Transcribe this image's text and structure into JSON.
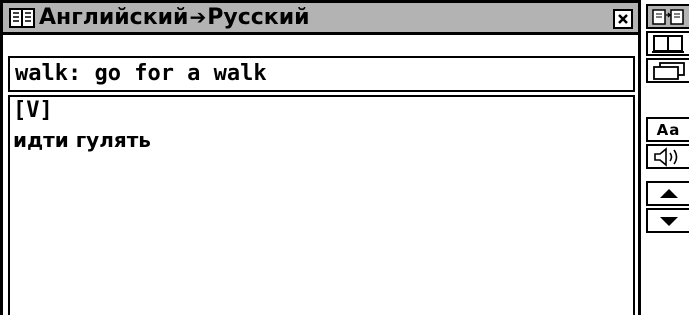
{
  "window": {
    "title_from": "Английский",
    "title_arrow": "➔",
    "title_to": "Русский",
    "close_glyph": "×"
  },
  "input": {
    "value": "walk: go for a walk"
  },
  "entry": {
    "part_of_speech": "[V]",
    "translation": "идти гулять"
  },
  "toolbar": {
    "buttons": [
      {
        "icon": "swap-languages-icon"
      },
      {
        "icon": "dictionary-book-icon"
      },
      {
        "icon": "cards-icon"
      },
      {
        "icon": "font-size-icon",
        "label": "Aa"
      },
      {
        "icon": "speaker-icon"
      },
      {
        "icon": "scroll-up-icon"
      },
      {
        "icon": "scroll-down-icon"
      }
    ]
  },
  "colors": {
    "titlebar": "#b3b3b3",
    "border": "#000000",
    "background": "#ffffff"
  }
}
